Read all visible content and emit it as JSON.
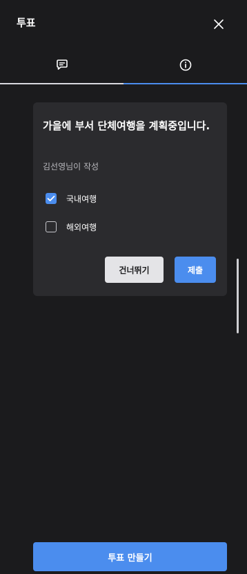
{
  "header": {
    "title": "투표",
    "close_icon": "close-icon"
  },
  "tabs": [
    {
      "icon": "chat-bubble-icon",
      "active": false
    },
    {
      "icon": "info-icon",
      "active": true
    }
  ],
  "poll": {
    "question": "가을에 부서 단체여행을 계획중입니다.",
    "author": "김선영님이 작성",
    "options": [
      {
        "label": "국내여행",
        "checked": true
      },
      {
        "label": "해외여행",
        "checked": false
      }
    ],
    "skip_label": "건너뛰기",
    "submit_label": "제출"
  },
  "footer": {
    "create_label": "투표 만들기"
  },
  "colors": {
    "background": "#1b1b1d",
    "card": "#2b2b2e",
    "accent": "#4b8dee",
    "skip_button": "#e4e4e7"
  }
}
